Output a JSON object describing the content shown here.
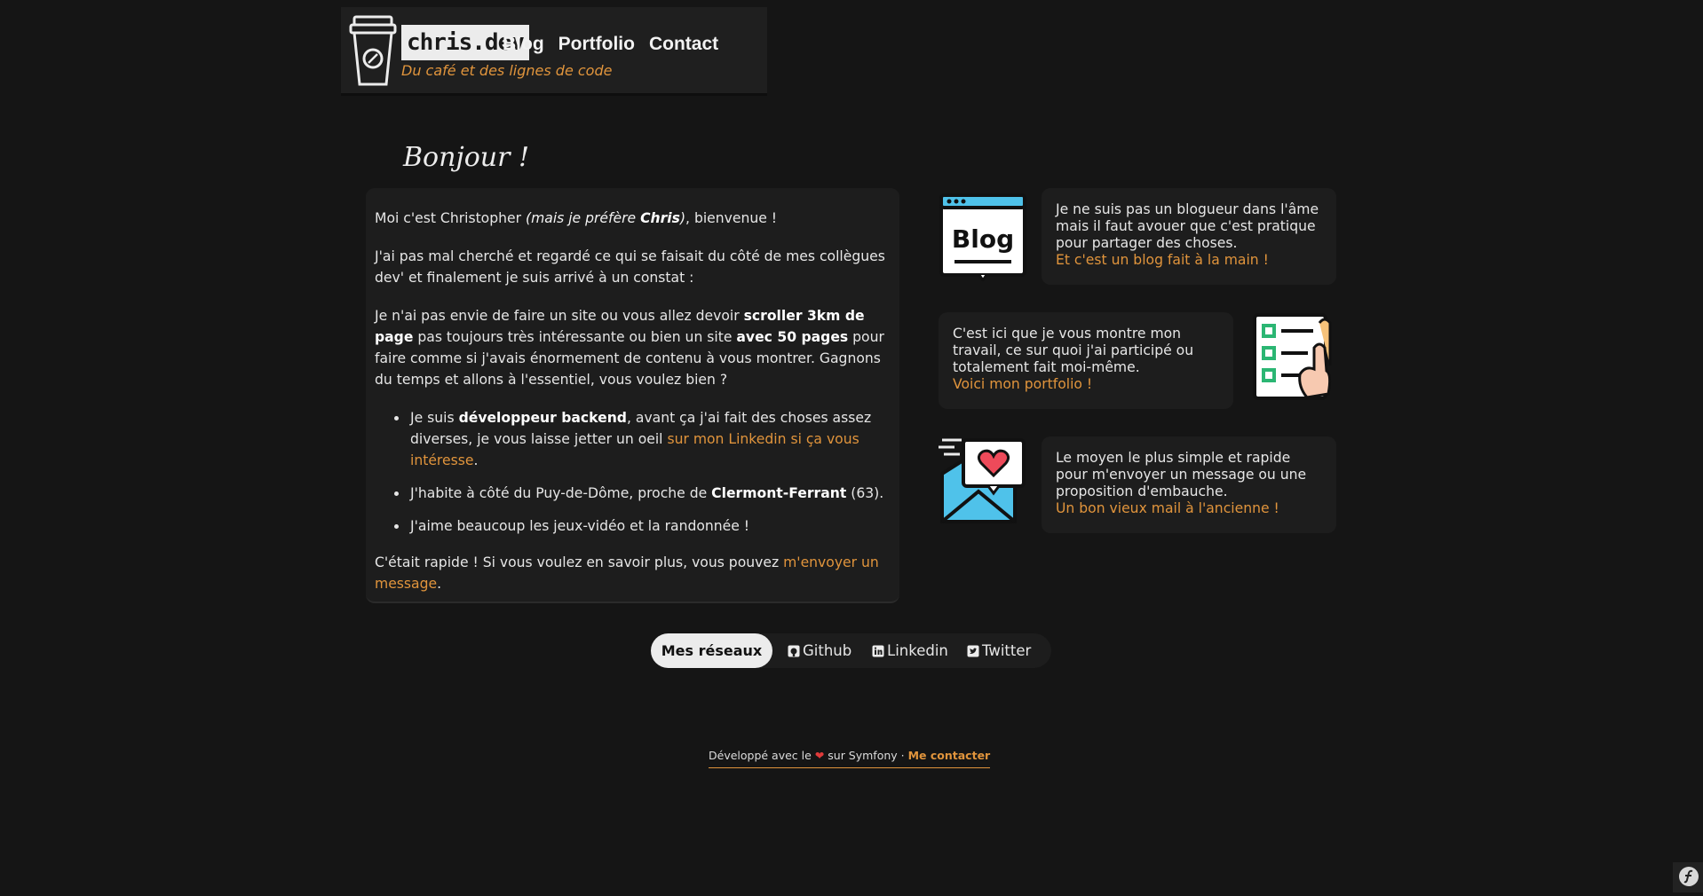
{
  "header": {
    "brand": "chris.dev",
    "tagline": "Du café et des lignes de code",
    "nav": [
      {
        "label": "Blog"
      },
      {
        "label": "Portfolio"
      },
      {
        "label": "Contact"
      }
    ]
  },
  "greeting": "Bonjour !",
  "intro": {
    "p1_a": "Moi c'est Christopher ",
    "p1_em_a": "(mais je préfère ",
    "p1_em_b": "Chris",
    "p1_em_c": ")",
    "p1_b": ", bienvenue !",
    "p2": "J'ai pas mal cherché et regardé ce qui se faisait du côté de mes collègues dev' et finalement je suis arrivé à un constat :",
    "p3_a": "Je n'ai pas envie de faire un site ou vous allez devoir ",
    "p3_b1": "scroller 3km de page",
    "p3_c": " pas toujours très intéressante ou bien un site ",
    "p3_b2": "avec 50 pages",
    "p3_d": " pour faire comme si j'avais énormement de contenu à vous montrer. Gagnons du temps et allons à l'essentiel, vous voulez bien ?",
    "li1_a": "Je suis ",
    "li1_b": "développeur backend",
    "li1_c": ", avant ça j'ai fait des choses assez diverses, je vous laisse jetter un oeil ",
    "li1_link": "sur mon Linkedin si ça vous intéresse",
    "li1_d": ".",
    "li2_a": "J'habite à côté du Puy-de-Dôme, proche de ",
    "li2_b": "Clermont-Ferrant",
    "li2_c": " (63).",
    "li3": "J'aime beaucoup les jeux-vidéo et la randonnée !",
    "p4_a": "C'était rapide ! Si vous voulez en savoir plus, vous pouvez ",
    "p4_link": "m'envoyer un message",
    "p4_b": "."
  },
  "features": {
    "blog": {
      "text": "Je ne suis pas un blogueur dans l'âme mais il faut avouer que c'est pratique pour partager des choses.",
      "link": "Et c'est un blog fait à la main !",
      "icon_label": "Blog"
    },
    "portfolio": {
      "text": "C'est ici que je vous montre mon travail, ce sur quoi j'ai participé ou totalement fait moi-même.",
      "link": "Voici mon portfolio !"
    },
    "contact": {
      "text": "Le moyen le plus simple et rapide pour m'envoyer un message ou une proposition d'embauche.",
      "link": "Un bon vieux mail à l'ancienne !"
    }
  },
  "socials": {
    "label": "Mes réseaux",
    "links": [
      {
        "label": "Github"
      },
      {
        "label": "Linkedin"
      },
      {
        "label": "Twitter"
      }
    ]
  },
  "footer": {
    "before": "Développé avec le ",
    "heart": "❤",
    "after": " sur Symfony · ",
    "contact": "Me contacter"
  },
  "colors": {
    "background": "#151515",
    "card": "#1d1d1d",
    "accent": "#e0943c"
  }
}
